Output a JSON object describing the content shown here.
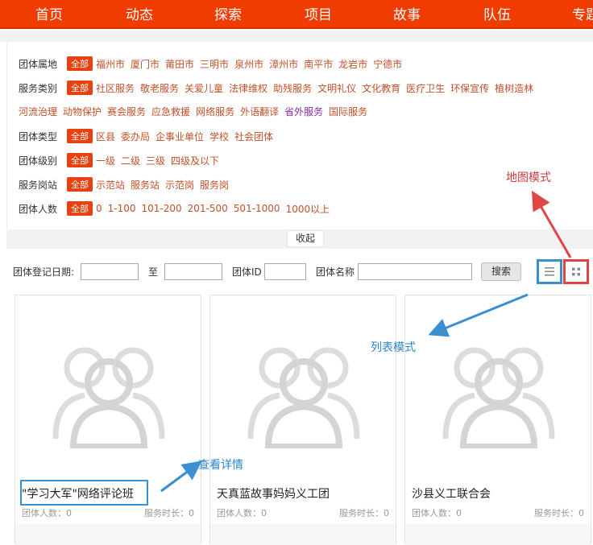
{
  "nav": [
    "首页",
    "动态",
    "探索",
    "项目",
    "故事",
    "队伍",
    "专题"
  ],
  "filters": {
    "all_label": "全部",
    "rows": [
      {
        "label": "团体属地",
        "options": [
          "福州市",
          "厦门市",
          "莆田市",
          "三明市",
          "泉州市",
          "漳州市",
          "南平市",
          "龙岩市",
          "宁德市"
        ]
      },
      {
        "label": "服务类别",
        "options": [
          "社区服务",
          "敬老服务",
          "关爱儿童",
          "法律维权",
          "助残服务",
          "文明礼仪",
          "文化教育",
          "医疗卫生",
          "环保宣传",
          "植树造林"
        ]
      },
      {
        "label": "",
        "options": [
          "河流治理",
          "动物保护",
          "赛会服务",
          "应急救援",
          "网络服务",
          "外语翻译",
          "省外服务",
          "国际服务"
        ]
      },
      {
        "label": "团体类型",
        "options": [
          "区县",
          "委办局",
          "企事业单位",
          "学校",
          "社会团体"
        ]
      },
      {
        "label": "团体级别",
        "options": [
          "一级",
          "二级",
          "三级",
          "四级及以下"
        ]
      },
      {
        "label": "服务岗站",
        "options": [
          "示范站",
          "服务站",
          "示范岗",
          "服务岗"
        ]
      },
      {
        "label": "团体人数",
        "options": [
          "0",
          "1-100",
          "101-200",
          "201-500",
          "501-1000",
          "1000以上"
        ]
      }
    ],
    "collapse_label": "收起"
  },
  "search": {
    "date_label": "团体登记日期:",
    "to_label": "至",
    "id_label": "团体ID",
    "name_label": "团体名称",
    "button": "搜索"
  },
  "cards": [
    {
      "title": "\"学习大军\"网络评论班",
      "members": "团体人数：0",
      "duration": "服务时长：0"
    },
    {
      "title": "天真蓝故事妈妈义工团",
      "members": "团体人数：0",
      "duration": "服务时长：0"
    },
    {
      "title": "沙县义工联合会",
      "members": "团体人数：0",
      "duration": "服务时长：0"
    }
  ],
  "annotations": {
    "map_mode": "地图模式",
    "list_mode": "列表模式",
    "view_details": "查看详情"
  },
  "colors": {
    "brand": "#f03c00",
    "chip": "#e8410f",
    "option": "#c0502a",
    "annotation_red": "#d33a3a",
    "annotation_blue": "#2a85cf"
  }
}
